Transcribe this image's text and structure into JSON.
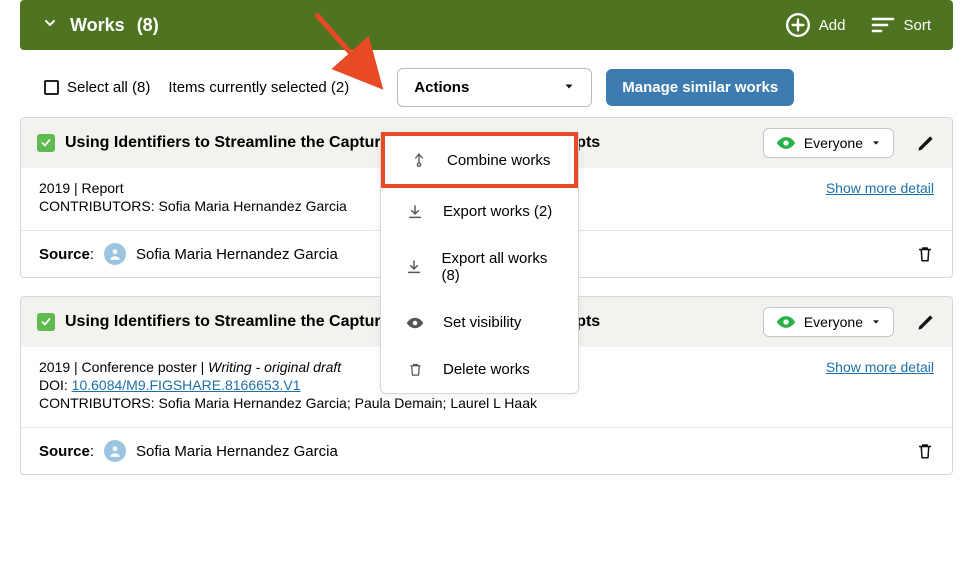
{
  "header": {
    "title": "Works",
    "count": "(8)",
    "add_label": "Add",
    "sort_label": "Sort"
  },
  "toolbar": {
    "select_all_label": "Select all (8)",
    "items_selected_label": "Items currently selected (2)",
    "actions_label": "Actions",
    "manage_label": "Manage similar works"
  },
  "dropdown": {
    "combine": "Combine works",
    "export": "Export works (2)",
    "export_all": "Export all works (8)",
    "set_visibility": "Set visibility",
    "delete": "Delete works"
  },
  "card_common": {
    "visibility_label": "Everyone",
    "show_more_label": "Show more detail",
    "source_label": "Source",
    "source_name": "Sofia Maria Hernandez Garcia"
  },
  "cards": [
    {
      "title": "Using Identifiers to Streamline the Capture of Metadata in Manuscripts",
      "meta": "2019 | Report",
      "contributors": "CONTRIBUTORS: Sofia Maria Hernandez Garcia"
    },
    {
      "title": "Using Identifiers to Streamline the Capture of Metadata in Manuscripts",
      "meta_prefix": "2019 | Conference poster | ",
      "meta_italic": "Writing - original draft",
      "doi_label": "DOI: ",
      "doi": "10.6084/M9.FIGSHARE.8166653.V1",
      "contributors": "CONTRIBUTORS: Sofia Maria Hernandez Garcia; Paula Demain; Laurel L Haak"
    }
  ]
}
